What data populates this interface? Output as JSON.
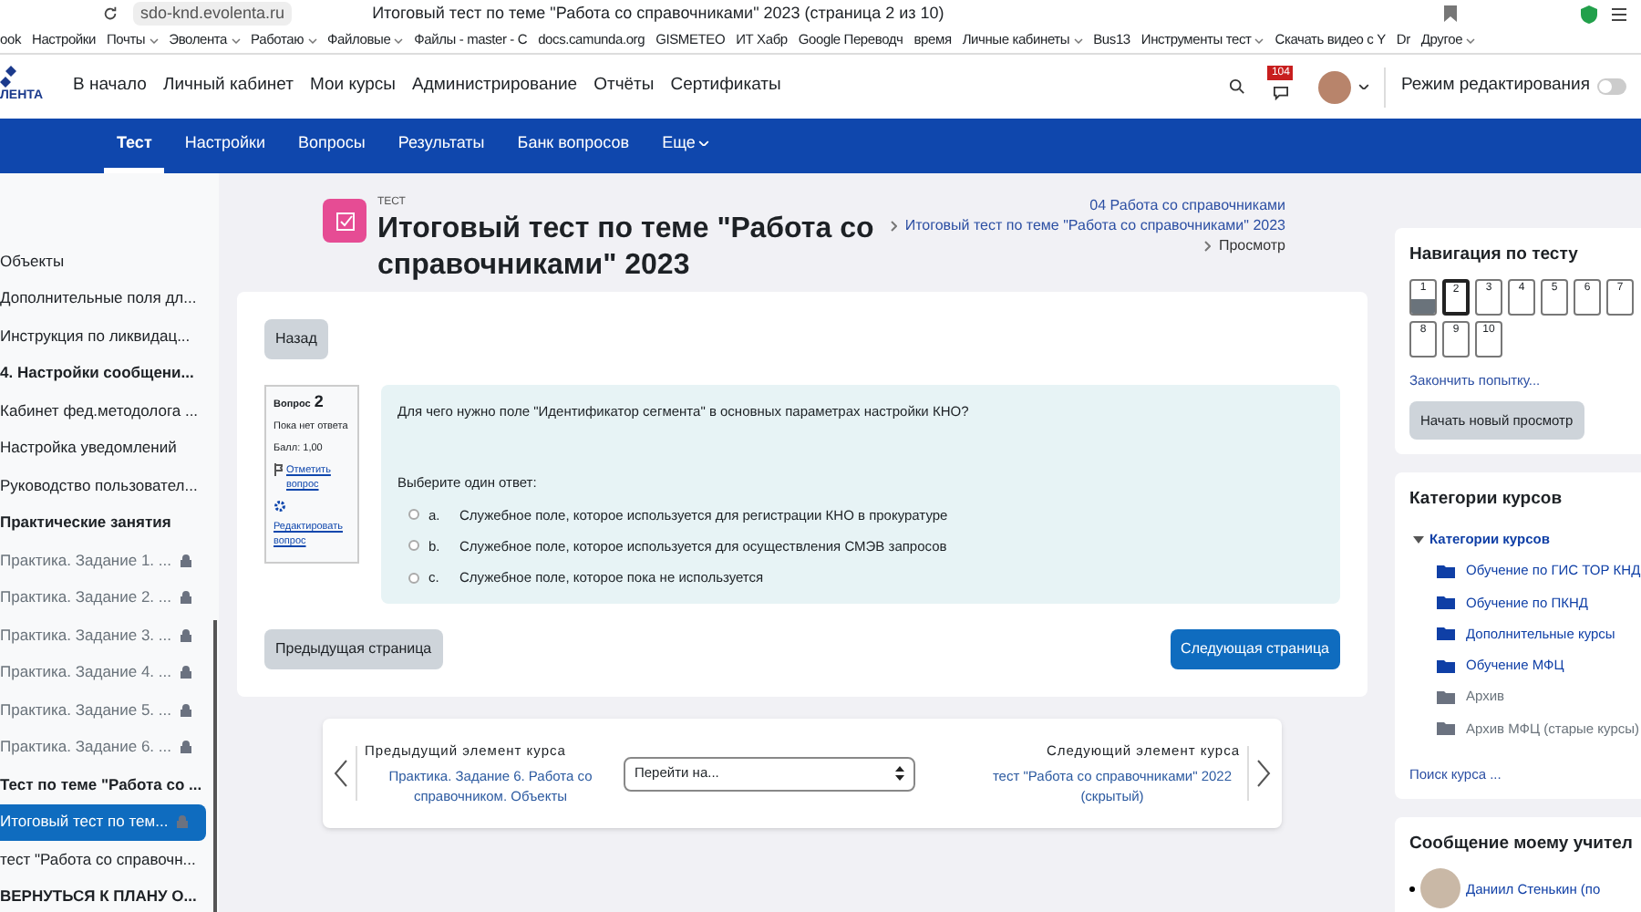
{
  "browser": {
    "url": "sdo-knd.evolenta.ru",
    "tab_title": "Итоговый тест по теме \"Работа со справочниками\" 2023 (страница 2 из 10)",
    "bookmarks": [
      {
        "label": "ook",
        "kind": "link"
      },
      {
        "label": "Настройки",
        "kind": "link"
      },
      {
        "label": "Почты",
        "kind": "folder"
      },
      {
        "label": "Эволента",
        "kind": "folder"
      },
      {
        "label": "Работаю",
        "kind": "folder"
      },
      {
        "label": "Файловые",
        "kind": "folder"
      },
      {
        "label": "Файлы - master - C",
        "kind": "link"
      },
      {
        "label": "docs.camunda.org",
        "kind": "link"
      },
      {
        "label": "GISMETEO",
        "kind": "link"
      },
      {
        "label": "ИТ Хабр",
        "kind": "link"
      },
      {
        "label": "Google Переводч",
        "kind": "link"
      },
      {
        "label": "время",
        "kind": "link"
      },
      {
        "label": "Личные кабинеты",
        "kind": "folder"
      },
      {
        "label": "Bus13",
        "kind": "link"
      },
      {
        "label": "Инструменты тест",
        "kind": "folder"
      },
      {
        "label": "Скачать видео с Y",
        "kind": "link"
      },
      {
        "label": "Dr",
        "kind": "link"
      },
      {
        "label": "Другое",
        "kind": "folder"
      }
    ]
  },
  "header": {
    "logo_text": "ЛЕНТА",
    "nav": [
      "В начало",
      "Личный кабинет",
      "Мои курсы",
      "Администрирование",
      "Отчёты",
      "Сертификаты"
    ],
    "notification_count": "104",
    "edit_mode": {
      "label": "Режим редактирования",
      "on": false
    }
  },
  "secondary_nav": [
    {
      "label": "Тест",
      "selected": true,
      "kind": "link"
    },
    {
      "label": "Настройки",
      "selected": false,
      "kind": "link"
    },
    {
      "label": "Вопросы",
      "selected": false,
      "kind": "link"
    },
    {
      "label": "Результаты",
      "selected": false,
      "kind": "link"
    },
    {
      "label": "Банк вопросов",
      "selected": false,
      "kind": "link"
    },
    {
      "label": "Еще",
      "selected": false,
      "kind": "menu"
    }
  ],
  "sidebar": {
    "items": [
      {
        "label": "Объекты",
        "kind": "item",
        "locked": false,
        "selected": false
      },
      {
        "label": "Дополнительные поля дл...",
        "kind": "item",
        "locked": false,
        "selected": false
      },
      {
        "label": "Инструкция по ликвидац...",
        "kind": "item",
        "locked": false,
        "selected": false
      },
      {
        "label": "4. Настройки сообщени...",
        "kind": "section",
        "locked": false,
        "selected": false
      },
      {
        "label": "Кабинет фед.методолога ...",
        "kind": "item",
        "locked": false,
        "selected": false
      },
      {
        "label": "Настройка уведомлений",
        "kind": "item",
        "locked": false,
        "selected": false
      },
      {
        "label": "Руководство пользовател...",
        "kind": "item",
        "locked": false,
        "selected": false
      },
      {
        "label": "Практические занятия",
        "kind": "section",
        "locked": false,
        "selected": false
      },
      {
        "label": "Практика. Задание 1. ...",
        "kind": "item",
        "locked": true,
        "selected": false
      },
      {
        "label": "Практика. Задание 2. ...",
        "kind": "item",
        "locked": true,
        "selected": false
      },
      {
        "label": "Практика. Задание 3. ...",
        "kind": "item",
        "locked": true,
        "selected": false
      },
      {
        "label": "Практика. Задание 4. ...",
        "kind": "item",
        "locked": true,
        "selected": false
      },
      {
        "label": "Практика. Задание 5. ...",
        "kind": "item",
        "locked": true,
        "selected": false
      },
      {
        "label": "Практика. Задание 6. ...",
        "kind": "item",
        "locked": true,
        "selected": false
      },
      {
        "label": "Тест по теме \"Работа со ...",
        "kind": "section",
        "locked": false,
        "selected": false
      },
      {
        "label": "Итоговый тест по тем...",
        "kind": "item",
        "locked": true,
        "selected": true
      },
      {
        "label": "тест \"Работа со справочн...",
        "kind": "item",
        "locked": false,
        "selected": false
      },
      {
        "label": "ВЕРНУТЬСЯ К ПЛАНУ О...",
        "kind": "section",
        "locked": false,
        "selected": false
      }
    ]
  },
  "page": {
    "kicker": "ТЕСТ",
    "title": "Итоговый тест по теме \"Работа со справочниками\" 2023",
    "breadcrumbs": [
      {
        "label": "04 Работа со справочниками",
        "kind": "link"
      },
      {
        "label": "Итоговый тест по теме \"Работа со справочниками\" 2023",
        "kind": "link"
      },
      {
        "label": "Просмотр",
        "kind": "current"
      }
    ]
  },
  "question": {
    "back_button": "Назад",
    "number_label": "Вопрос",
    "number": "2",
    "status": "Пока нет ответа",
    "mark": "Балл: 1,00",
    "flag_link": "Отметить вопрос",
    "edit_link": "Редактировать вопрос",
    "text": "Для чего нужно поле \"Идентификатор сегмента\" в основных параметрах настройки КНО?",
    "prompt": "Выберите один ответ:",
    "options": [
      {
        "letter": "a.",
        "text": "Служебное поле, которое используется для регистрации КНО в прокуратуре",
        "selected": false
      },
      {
        "letter": "b.",
        "text": "Служебное поле, которое используется для осуществления СМЭВ запросов",
        "selected": false
      },
      {
        "letter": "c.",
        "text": "Служебное поле, которое пока не используется",
        "selected": false
      }
    ]
  },
  "page_buttons": {
    "previous": "Предыдущая страница",
    "next": "Следующая страница"
  },
  "activity_nav": {
    "prev_label": "Предыдущий элемент курса",
    "prev_link": "Практика. Задание 6. Работа со справочником. Объекты",
    "jump_placeholder": "Перейти на...",
    "next_label": "Следующий элемент курса",
    "next_link": "тест \"Работа со справочниками\" 2022 (скрытый)"
  },
  "quiz_nav": {
    "title": "Навигация по тесту",
    "pages": [
      {
        "label": "1",
        "answered": true,
        "current": false
      },
      {
        "label": "2",
        "answered": false,
        "current": true
      },
      {
        "label": "3",
        "answered": false,
        "current": false
      },
      {
        "label": "4",
        "answered": false,
        "current": false
      },
      {
        "label": "5",
        "answered": false,
        "current": false
      },
      {
        "label": "6",
        "answered": false,
        "current": false
      },
      {
        "label": "7",
        "answered": false,
        "current": false
      },
      {
        "label": "8",
        "answered": false,
        "current": false
      },
      {
        "label": "9",
        "answered": false,
        "current": false
      },
      {
        "label": "10",
        "answered": false,
        "current": false
      }
    ],
    "finish_link": "Закончить попытку...",
    "restart_button": "Начать новый просмотр"
  },
  "categories": {
    "title": "Категории курсов",
    "root": "Категории курсов",
    "items": [
      {
        "label": "Обучение по ГИС ТОР КНД",
        "hidden": false
      },
      {
        "label": "Обучение по ПКНД",
        "hidden": false
      },
      {
        "label": "Дополнительные курсы",
        "hidden": false
      },
      {
        "label": "Обучение МФЦ",
        "hidden": false
      },
      {
        "label": "Архив",
        "hidden": true
      },
      {
        "label": "Архив МФЦ (старые курсы)",
        "hidden": true
      }
    ],
    "search_link": "Поиск курса ..."
  },
  "message": {
    "title": "Сообщение моему учител",
    "contacts": [
      "Даниил Стенькин (по"
    ]
  }
}
